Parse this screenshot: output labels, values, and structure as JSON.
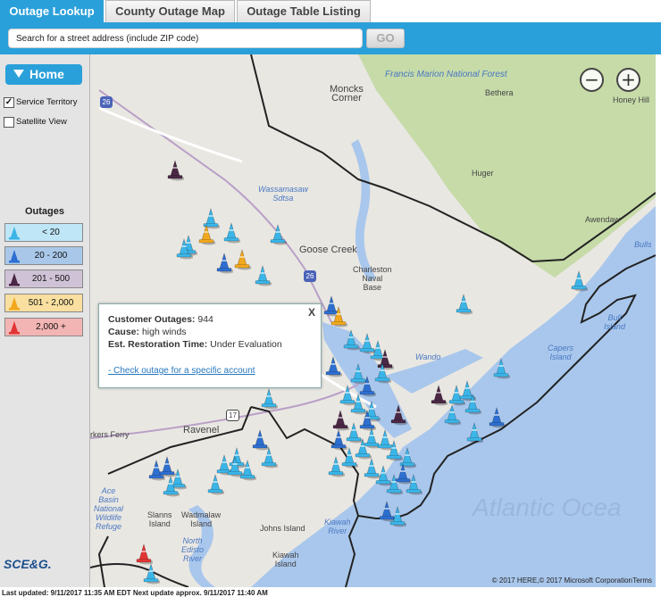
{
  "tabs": [
    {
      "label": "Outage Lookup",
      "active": true
    },
    {
      "label": "County Outage Map",
      "active": false
    },
    {
      "label": "Outage Table Listing",
      "active": false
    }
  ],
  "search": {
    "placeholder": "Search for a street address (include ZIP code)",
    "go_label": "GO"
  },
  "sidebar": {
    "home_label": "Home",
    "service_territory": {
      "label": "Service Territory",
      "checked": true
    },
    "satellite_view": {
      "label": "Satellite View",
      "checked": false
    },
    "outages_title": "Outages",
    "legend": [
      {
        "label": "< 20",
        "bg": "#bfe6f6",
        "cone": "#3bb5e8"
      },
      {
        "label": "20 - 200",
        "bg": "#a9c8e9",
        "cone": "#2d6fd0"
      },
      {
        "label": "201 - 500",
        "bg": "#cfc2d6",
        "cone": "#4a2745"
      },
      {
        "label": "501 - 2,000",
        "bg": "#f9dfa0",
        "cone": "#f2a81d"
      },
      {
        "label": "2,000 +",
        "bg": "#f3b4b4",
        "cone": "#e23434"
      }
    ],
    "logo_text": "SCE&G."
  },
  "map": {
    "labels": {
      "national_forest": "Francis Marion National Forest",
      "moncks_corner": "Moncks\nCorner",
      "bethera": "Bethera",
      "honey_hill": "Honey Hill",
      "huger": "Huger",
      "wassamasaw": "Wassamasaw\nSdtsa",
      "awendaw": "Awendaw",
      "goose_creek": "Goose Creek",
      "charleston_naval": "Charleston\nNaval\nBase",
      "bulls": "Bulls",
      "bull_island": "Bull\nIsland",
      "wando": "Wando",
      "capers_island": "Capers\nIsland",
      "ravenel": "Ravenel",
      "parkers_ferry": "rkers Ferry",
      "ace_basin": "Ace\nBasin\nNational\nWildlife\nRefuge",
      "slanns_island": "Slanns\nIsland",
      "wadmalaw_island": "Wadmalaw\nIsland",
      "johns_island": "Johns Island",
      "north_edisto": "North\nEdisto\nRiver",
      "kiawah_river": "Kiawah\nRiver",
      "kiawah_island": "Kiawah\nIsland",
      "atlantic": "Atlantic Ocea",
      "hwy_26_a": "26",
      "hwy_26_b": "26",
      "hwy_17": "17"
    },
    "zoom_out": "−",
    "zoom_in": "+",
    "copyright": "© 2017 HERE,© 2017 Microsoft Corporation",
    "terms": "Terms"
  },
  "popup": {
    "close": "X",
    "customer_outages_label": "Customer Outages:",
    "customer_outages_value": "944",
    "cause_label": "Cause:",
    "cause_value": "high winds",
    "restoration_label": "Est. Restoration Time:",
    "restoration_value": "Under Evaluation",
    "link": "- Check outage for a specific account"
  },
  "status": "Last updated: 9/11/2017 11:35 AM EDT     Next update approx. 9/11/2017 11:40 AM"
}
